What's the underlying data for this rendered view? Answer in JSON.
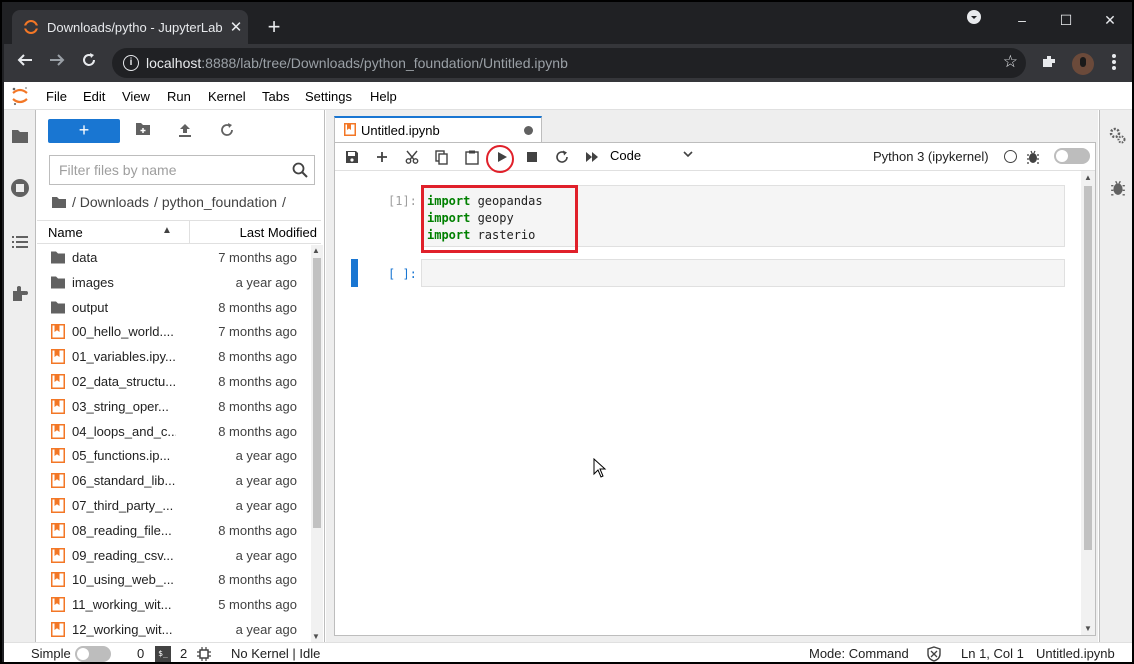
{
  "browser": {
    "tab_title": "Downloads/pytho - JupyterLab",
    "tab_close": "✕",
    "new_tab": "+",
    "url_host": "localhost",
    "url_rest": ":8888/lab/tree/Downloads/python_foundation/Untitled.ipynb",
    "window_controls": [
      "–",
      "☐",
      "✕"
    ]
  },
  "menubar": {
    "items": [
      "File",
      "Edit",
      "View",
      "Run",
      "Kernel",
      "Tabs",
      "Settings",
      "Help"
    ]
  },
  "filebrowser": {
    "new_label": "+",
    "filter_placeholder": "Filter files by name",
    "breadcrumb": [
      "/ Downloads",
      "/ python_foundation",
      "/"
    ],
    "col_name": "Name",
    "col_modified": "Last Modified",
    "files": [
      {
        "name": "data",
        "modified": "7 months ago",
        "type": "folder"
      },
      {
        "name": "images",
        "modified": "a year ago",
        "type": "folder"
      },
      {
        "name": "output",
        "modified": "8 months ago",
        "type": "folder"
      },
      {
        "name": "00_hello_world....",
        "modified": "7 months ago",
        "type": "notebook"
      },
      {
        "name": "01_variables.ipy...",
        "modified": "8 months ago",
        "type": "notebook"
      },
      {
        "name": "02_data_structu...",
        "modified": "8 months ago",
        "type": "notebook"
      },
      {
        "name": "03_string_oper...",
        "modified": "8 months ago",
        "type": "notebook"
      },
      {
        "name": "04_loops_and_c...",
        "modified": "8 months ago",
        "type": "notebook"
      },
      {
        "name": "05_functions.ip...",
        "modified": "a year ago",
        "type": "notebook"
      },
      {
        "name": "06_standard_lib...",
        "modified": "a year ago",
        "type": "notebook"
      },
      {
        "name": "07_third_party_...",
        "modified": "a year ago",
        "type": "notebook"
      },
      {
        "name": "08_reading_file...",
        "modified": "8 months ago",
        "type": "notebook"
      },
      {
        "name": "09_reading_csv...",
        "modified": "a year ago",
        "type": "notebook"
      },
      {
        "name": "10_using_web_...",
        "modified": "8 months ago",
        "type": "notebook"
      },
      {
        "name": "11_working_wit...",
        "modified": "5 months ago",
        "type": "notebook"
      },
      {
        "name": "12_working_wit...",
        "modified": "a year ago",
        "type": "notebook"
      }
    ]
  },
  "notebook": {
    "tab_title": "Untitled.ipynb",
    "cell_type": "Code",
    "kernel_name": "Python 3 (ipykernel)",
    "cell1_prompt": "[1]:",
    "cell1_lines": [
      {
        "kw": "import",
        "mod": " geopandas"
      },
      {
        "kw": "import",
        "mod": " geopy"
      },
      {
        "kw": "import",
        "mod": " rasterio"
      }
    ],
    "cell2_prompt": "[ ]:"
  },
  "statusbar": {
    "simple_label": "Simple",
    "terminals_count": "0",
    "terminal_icon": "$_",
    "kernels_count": "2",
    "kernel_status": "No Kernel | Idle",
    "mode": "Mode: Command",
    "cursor_pos": "Ln 1, Col 1",
    "file_name": "Untitled.ipynb"
  },
  "colors": {
    "accent": "#1976d2",
    "highlight": "#e0202a",
    "notebook_icon": "#f37726"
  }
}
